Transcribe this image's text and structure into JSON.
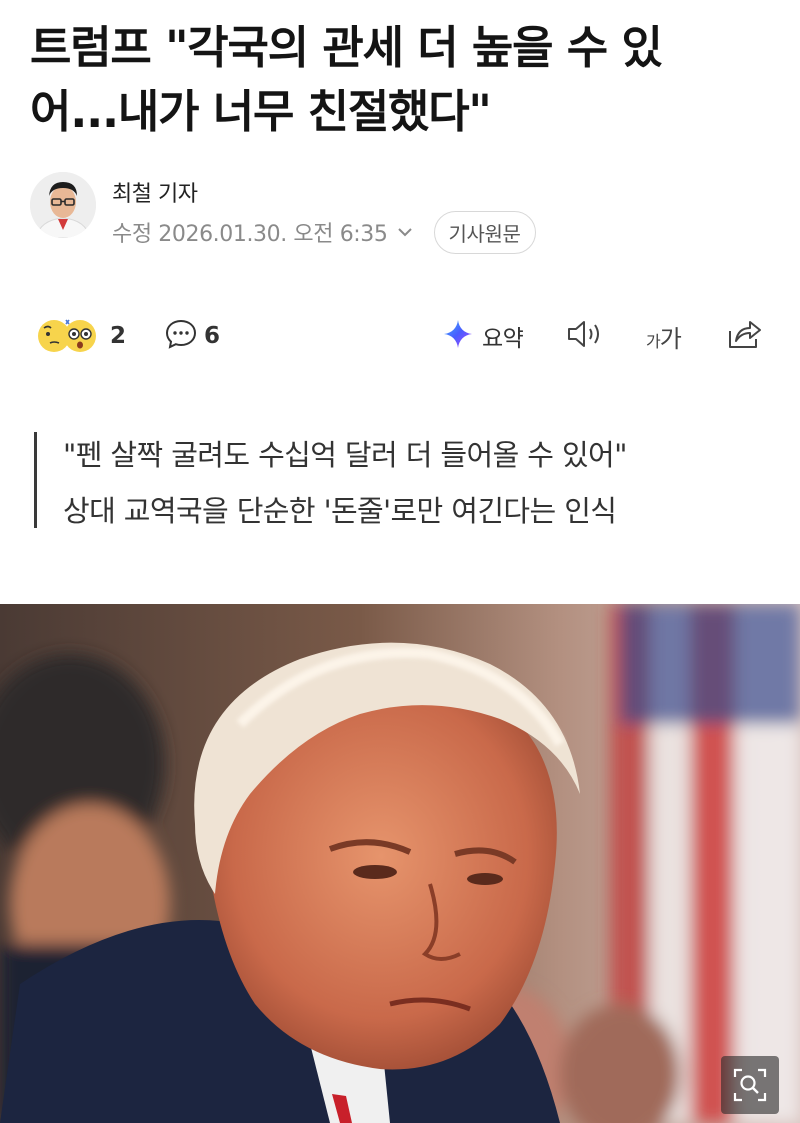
{
  "article": {
    "headline_line1": "트럼프 \"각국의 관세 더 높을 수 있",
    "headline_line2": "어...내가 너무 친절했다\"",
    "reporter": "최철 기자",
    "timestamp": "수정 2026.01.30. 오전 6:35",
    "original_button": "기사원문",
    "subheadline": [
      "\"펜 살짝 굴려도 수십억 달러 더 들어올 수 있어\"",
      "상대 교역국을 단순한 '돈줄'로만 여긴다는 인식"
    ]
  },
  "actions": {
    "reaction_count": "2",
    "comment_count": "6",
    "summary_label": "요약",
    "font_size_small": "가",
    "font_size_large": "가"
  },
  "icons": {
    "reaction": "emoji-reaction-icon",
    "comment": "comment-icon",
    "summary": "ai-summary-sparkle-icon",
    "tts": "speaker-icon",
    "font_size": "font-size-icon",
    "share": "share-icon",
    "zoom": "zoom-magnifier-icon",
    "chevron": "chevron-down-icon"
  },
  "colors": {
    "summary_accent": "#4a5cff",
    "reaction_yellow": "#f7d44c",
    "text_muted": "#8a8a8a"
  }
}
